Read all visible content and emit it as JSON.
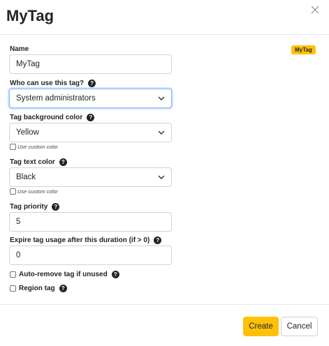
{
  "modal": {
    "title": "MyTag"
  },
  "preview": {
    "badge_text": "MyTag",
    "badge_color": "#ffc107"
  },
  "form": {
    "name": {
      "label": "Name",
      "value": "MyTag"
    },
    "who_can_use": {
      "label": "Who can use this tag?",
      "selected": "System administrators"
    },
    "bg_color": {
      "label": "Tag background color",
      "selected": "Yellow",
      "custom_label": "Use custom color"
    },
    "text_color": {
      "label": "Tag text color",
      "selected": "Black",
      "custom_label": "Use custom color"
    },
    "priority": {
      "label": "Tag priority",
      "value": "5"
    },
    "expire": {
      "label": "Expire tag usage after this duration (if > 0)",
      "value": "0"
    },
    "auto_remove": {
      "label": "Auto-remove tag if unused"
    },
    "region_tag": {
      "label": "Region tag"
    }
  },
  "help_icon": "?",
  "footer": {
    "create_label": "Create",
    "cancel_label": "Cancel"
  },
  "colors": {
    "accent": "#ffc107",
    "focus": "#86b7fe"
  }
}
